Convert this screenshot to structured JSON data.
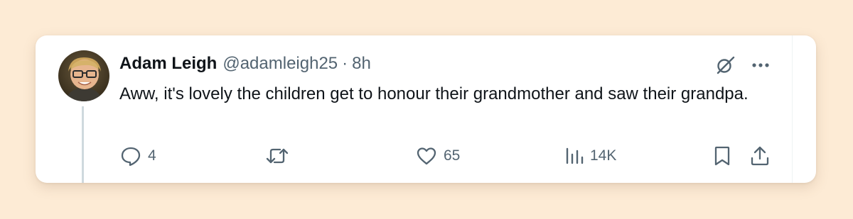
{
  "tweet": {
    "author_name": "Adam Leigh",
    "handle": "@adamleigh25",
    "separator": "·",
    "time": "8h",
    "text": "Aww, it's lovely the children get to honour their grandmother and saw their grandpa."
  },
  "actions": {
    "replies": "4",
    "retweets": "",
    "likes": "65",
    "views": "14K"
  },
  "icons": {
    "header": [
      "grok-icon",
      "more-icon"
    ],
    "actions": [
      "reply-icon",
      "retweet-icon",
      "like-icon",
      "views-icon",
      "bookmark-icon",
      "share-icon"
    ]
  },
  "colors": {
    "page_background": "#FDEBD5",
    "card_background": "#FFFFFF",
    "text_primary": "#0F1419",
    "text_secondary": "#536471",
    "thread_line": "#CFD9DE"
  }
}
